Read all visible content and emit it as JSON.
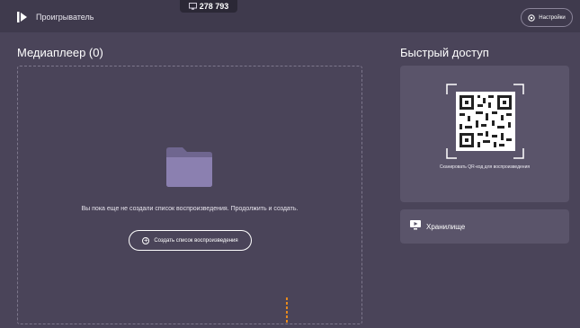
{
  "header": {
    "app_title": "Проигрыватель",
    "counter": "278 793",
    "counter_icon": "screen-icon",
    "settings_label": "Настройки",
    "settings_icon": "gear-icon",
    "logo_icon": "player-logo-icon"
  },
  "media": {
    "title": "Медиаплеер (0)",
    "empty_message": "Вы пока еще не создали список воспроизведения. Продолжить и создать.",
    "create_button_label": "Создать список воспроизведения",
    "create_icon": "plus-circle-icon",
    "folder_icon": "folder-icon"
  },
  "quick_access": {
    "title": "Быстрый доступ",
    "qr_caption": "Сканировать QR-код для воспроизведения",
    "qr_icon": "qr-code-icon",
    "storage_label": "Хранилище",
    "storage_icon": "storage-monitor-icon"
  },
  "colors": {
    "background": "#4a4459",
    "topbar": "#3f3a4d",
    "card": "#5a546a",
    "folder": "#8b80b0",
    "accent": "#e68a1e"
  }
}
